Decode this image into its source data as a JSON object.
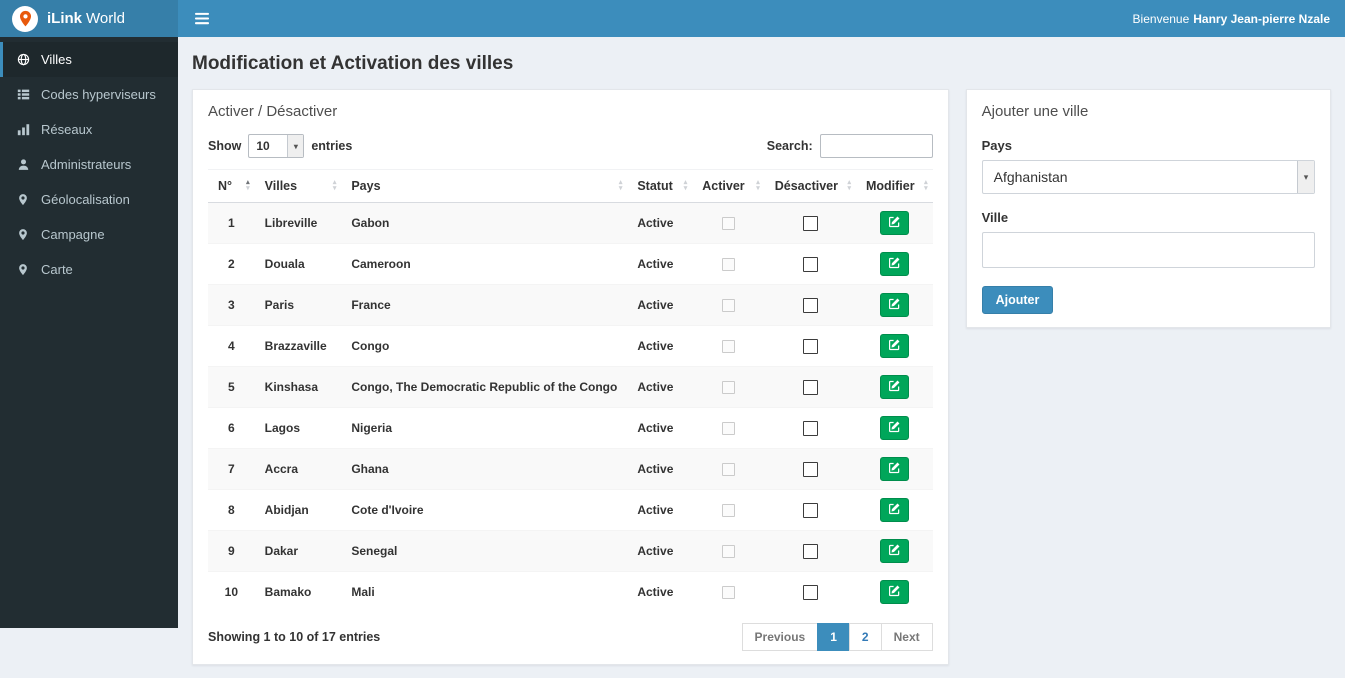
{
  "colors": {
    "navbar": "#3c8dbc",
    "logo_bg": "#367fa9",
    "sidebar_bg": "#222d32",
    "accent_green": "#00a65a",
    "content_bg": "#ecf0f5"
  },
  "app": {
    "brand_bold": "iLink",
    "brand_rest": "World",
    "welcome_prefix": "Bienvenue",
    "welcome_user": "Hanry Jean-pierre Nzale"
  },
  "sidebar": {
    "items": [
      {
        "id": "villes",
        "label": "Villes",
        "icon": "globe-icon",
        "active": true
      },
      {
        "id": "codes-hyperviseurs",
        "label": "Codes hyperviseurs",
        "icon": "list-icon",
        "active": false
      },
      {
        "id": "reseaux",
        "label": "Réseaux",
        "icon": "bar-chart-icon",
        "active": false
      },
      {
        "id": "administrateurs",
        "label": "Administrateurs",
        "icon": "user-icon",
        "active": false
      },
      {
        "id": "geolocalisation",
        "label": "Géolocalisation",
        "icon": "map-marker-icon",
        "active": false
      },
      {
        "id": "campagne",
        "label": "Campagne",
        "icon": "map-marker-icon",
        "active": false
      },
      {
        "id": "carte",
        "label": "Carte",
        "icon": "map-marker-icon",
        "active": false
      }
    ]
  },
  "page": {
    "title": "Modification et Activation des villes"
  },
  "table_panel": {
    "title": "Activer / Désactiver",
    "show_label": "Show",
    "page_length": "10",
    "entries_label": "entries",
    "search_label": "Search:",
    "search_value": "",
    "columns": [
      "N°",
      "Villes",
      "Pays",
      "Statut",
      "Activer",
      "Désactiver",
      "Modifier"
    ],
    "rows": [
      {
        "num": "1",
        "ville": "Libreville",
        "pays": "Gabon",
        "statut": "Active"
      },
      {
        "num": "2",
        "ville": "Douala",
        "pays": "Cameroon",
        "statut": "Active"
      },
      {
        "num": "3",
        "ville": "Paris",
        "pays": "France",
        "statut": "Active"
      },
      {
        "num": "4",
        "ville": "Brazzaville",
        "pays": "Congo",
        "statut": "Active"
      },
      {
        "num": "5",
        "ville": "Kinshasa",
        "pays": "Congo, The Democratic Republic of the Congo",
        "statut": "Active"
      },
      {
        "num": "6",
        "ville": "Lagos",
        "pays": "Nigeria",
        "statut": "Active"
      },
      {
        "num": "7",
        "ville": "Accra",
        "pays": "Ghana",
        "statut": "Active"
      },
      {
        "num": "8",
        "ville": "Abidjan",
        "pays": "Cote d'Ivoire",
        "statut": "Active"
      },
      {
        "num": "9",
        "ville": "Dakar",
        "pays": "Senegal",
        "statut": "Active"
      },
      {
        "num": "10",
        "ville": "Bamako",
        "pays": "Mali",
        "statut": "Active"
      }
    ],
    "checkbox_states": {
      "activer": {
        "checked": false,
        "disabled": true
      },
      "desactiver": {
        "checked": false,
        "disabled": false
      }
    },
    "footer_info": "Showing 1 to 10 of 17 entries",
    "pagination": {
      "previous_label": "Previous",
      "pages": [
        "1",
        "2"
      ],
      "active_page": "1",
      "next_label": "Next"
    }
  },
  "add_panel": {
    "title": "Ajouter une ville",
    "pays_label": "Pays",
    "pays_value": "Afghanistan",
    "ville_label": "Ville",
    "ville_value": "",
    "submit_label": "Ajouter"
  }
}
